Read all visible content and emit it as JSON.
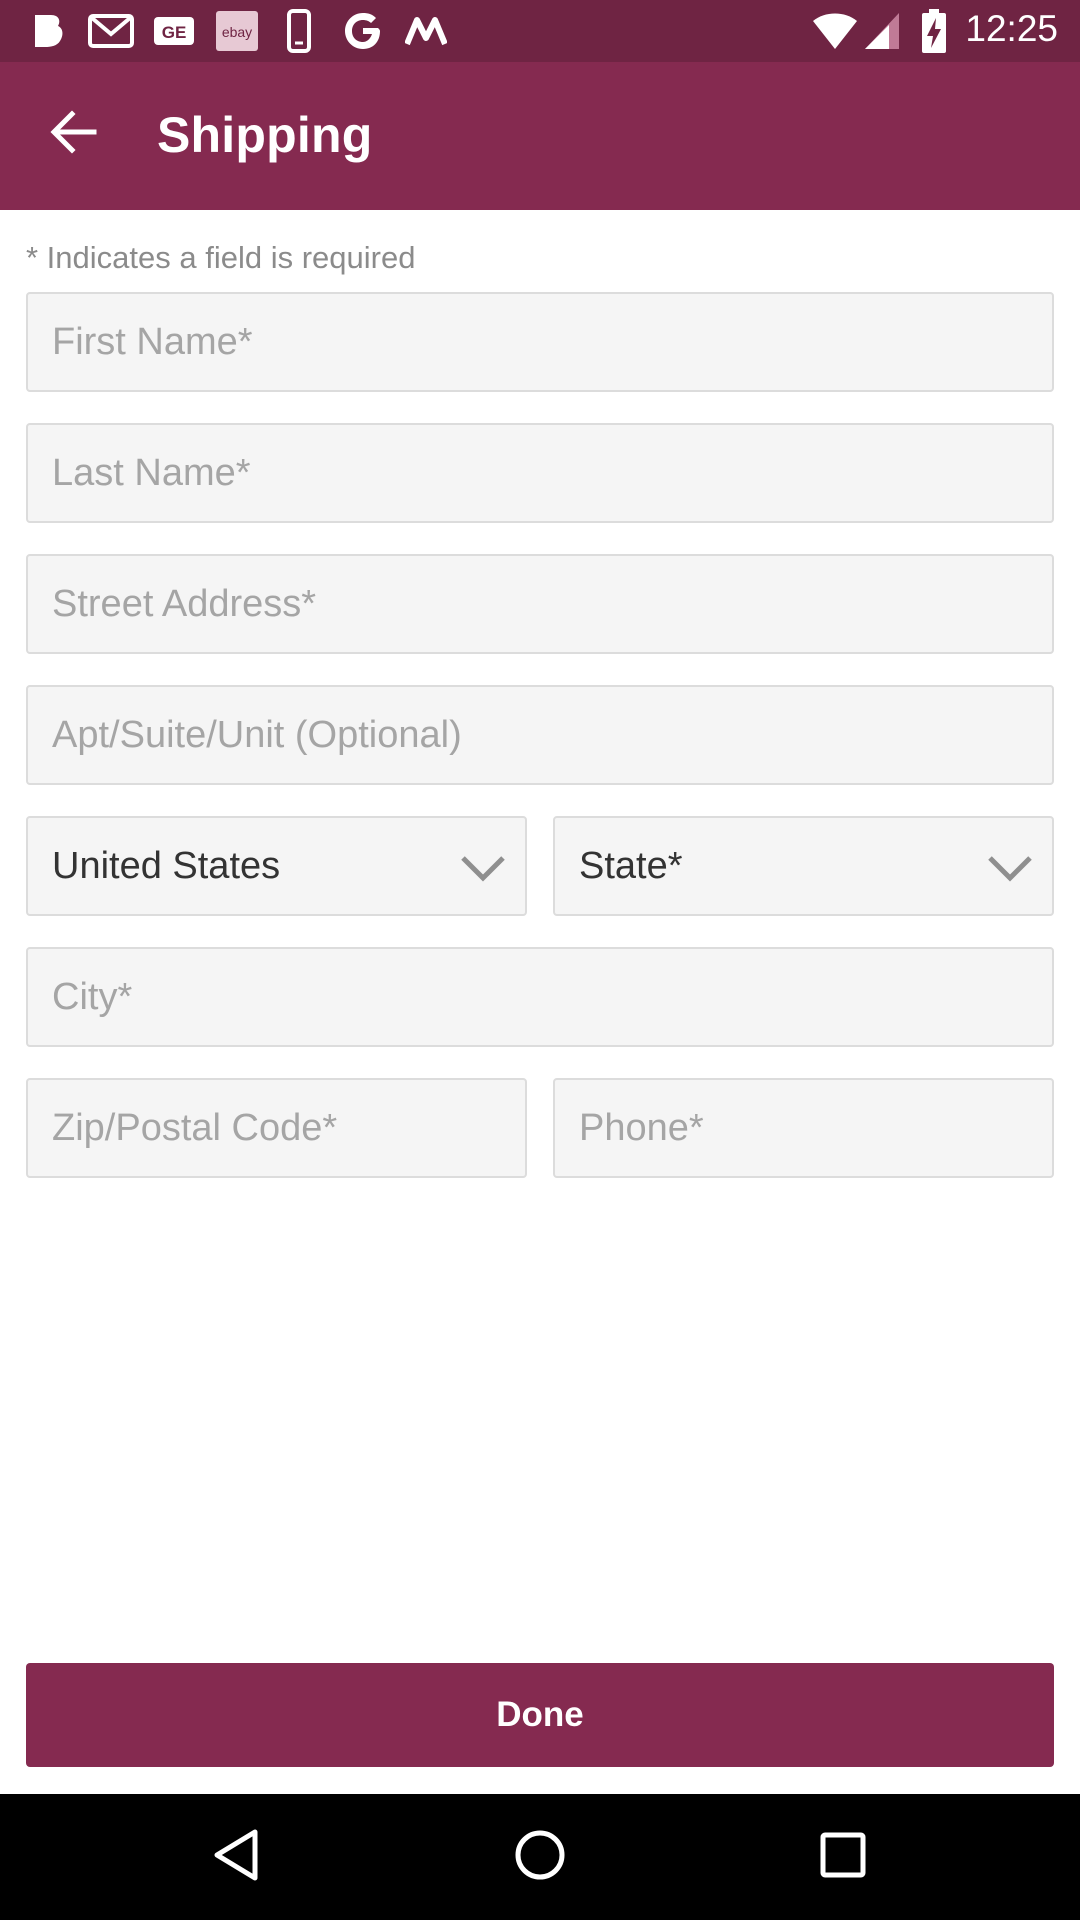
{
  "status_bar": {
    "time": "12:25",
    "notification_icons": [
      "b-app-icon",
      "gmail-icon",
      "ge-icon",
      "ebay-icon",
      "phone-icon",
      "google-icon",
      "m-app-icon"
    ],
    "ebay_label": "ebay",
    "ge_label": "GE",
    "system_icons": [
      "wifi-icon",
      "signal-icon",
      "battery-charging-icon"
    ]
  },
  "app_bar": {
    "title": "Shipping",
    "back_icon": "arrow-left-icon"
  },
  "form": {
    "required_note": "* Indicates a field is required",
    "first_name_placeholder": "First Name*",
    "last_name_placeholder": "Last Name*",
    "street_placeholder": "Street Address*",
    "apt_placeholder": "Apt/Suite/Unit (Optional)",
    "country_value": "United States",
    "state_value": "State*",
    "city_placeholder": "City*",
    "zip_placeholder": "Zip/Postal Code*",
    "phone_placeholder": "Phone*"
  },
  "done_label": "Done",
  "colors": {
    "status_bar": "#6f2443",
    "brand": "#852a50",
    "field_bg": "#f5f5f5",
    "placeholder": "#a5a5a5"
  },
  "nav_bar": {
    "icons": [
      "back-triangle-icon",
      "home-circle-icon",
      "recents-square-icon"
    ]
  }
}
